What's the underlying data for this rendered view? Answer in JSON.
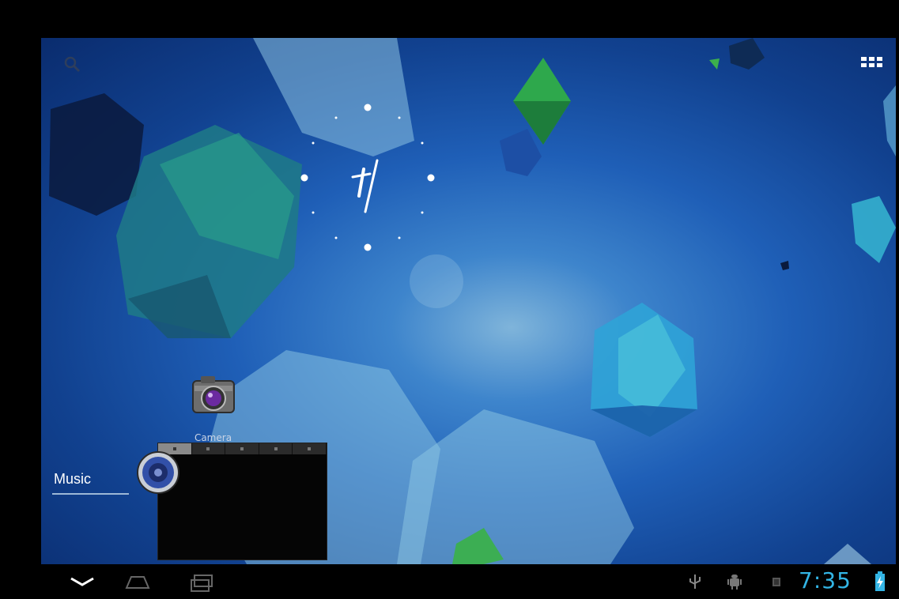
{
  "home": {
    "camera_label": "Camera",
    "music_label": "Music"
  },
  "status_bar": {
    "time": "7:35",
    "icons": [
      "usb-icon",
      "android-debug-icon",
      "sd-card-icon",
      "battery-charging-icon"
    ]
  },
  "nav_bar": {
    "buttons": [
      "back-button",
      "home-button",
      "recent-apps-button"
    ]
  },
  "colors": {
    "clock_accent": "#33b5e5",
    "wallpaper_primary": "#1f5fb7"
  }
}
